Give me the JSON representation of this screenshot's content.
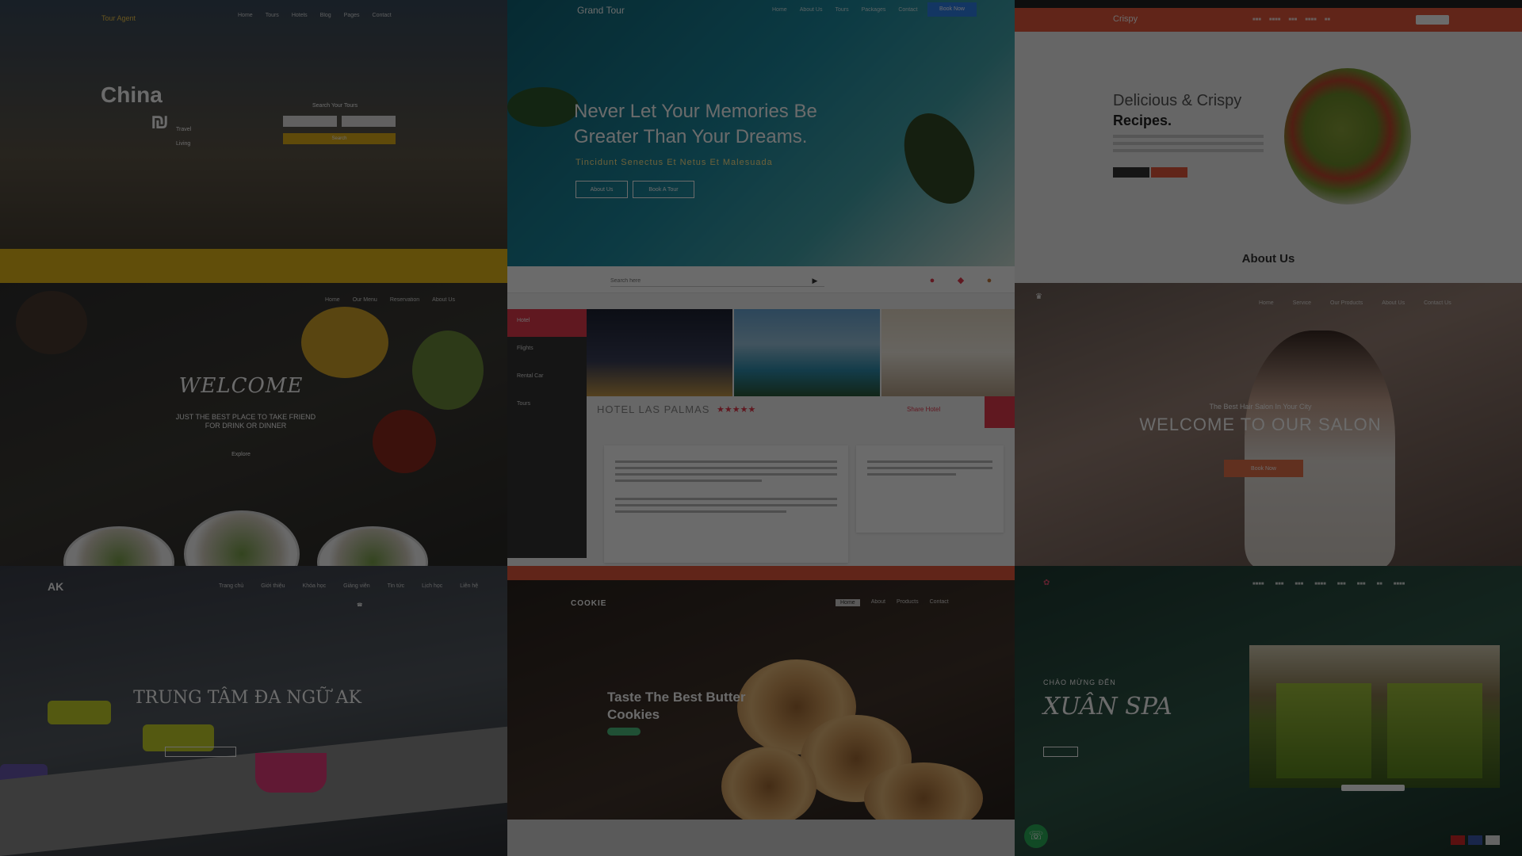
{
  "tiles": {
    "china": {
      "brand": "Tour Agent",
      "nav": [
        "Home",
        "Tours",
        "Hotels",
        "Blog",
        "Pages",
        "Contact"
      ],
      "headline": "China",
      "logo_glyph": "₪",
      "logo_items": [
        "Travel",
        "Living"
      ],
      "form_title": "Search Your Tours",
      "input1_placeholder": "",
      "input2_placeholder": "",
      "button": "Search"
    },
    "grand_tour": {
      "logo": "Grand Tour",
      "nav": [
        "Home",
        "About Us",
        "Tours",
        "Packages",
        "Contact"
      ],
      "book_button": "Book Now",
      "headline_line1": "Never Let Your Memories Be",
      "headline_line2": "Greater Than Your Dreams.",
      "subtitle": "Tincidunt Senectus Et Netus Et Malesuada",
      "button_about": "About Us",
      "button_book": "Book A Tour"
    },
    "crispy": {
      "logo": "Crispy",
      "headline_line1": "Delicious & Crispy",
      "headline_line2": "Recipes.",
      "about_heading": "About Us"
    },
    "restaurant": {
      "nav": [
        "Home",
        "Our Menu",
        "Reservation",
        "About Us"
      ],
      "welcome": "WELCOME",
      "tagline_line1": "JUST THE BEST PLACE TO TAKE FRIEND",
      "tagline_line2": "FOR DRINK OR DINNER",
      "link": "Explore"
    },
    "hotel": {
      "search_placeholder": "Search here",
      "sidebar": [
        "Hotel",
        "Flights",
        "Rental Car",
        "Tours"
      ],
      "hotel_name": "HOTEL LAS PALMAS",
      "stars": "★★★★★",
      "share": "Share Hotel"
    },
    "salon": {
      "nav": [
        "Home",
        "Service",
        "Our Products",
        "About Us",
        "Contact Us"
      ],
      "small_text": "The Best Hair Salon In Your City",
      "headline": "WELCOME TO OUR SALON",
      "button": "Book Now"
    },
    "language_center": {
      "logo": "AK",
      "nav": [
        "Trang chủ",
        "Giới thiệu",
        "Khóa học",
        "Giảng viên",
        "Tin tức",
        "Lịch học",
        "Liên hệ"
      ],
      "headline": "TRUNG TÂM ĐA NGỮ AK"
    },
    "cookie": {
      "logo": "COOKIE",
      "nav": [
        "Home",
        "About",
        "Products",
        "Contact"
      ],
      "headline_line1": "Taste The Best Butter",
      "headline_line2": "Cookies"
    },
    "spa": {
      "small_text": "CHÀO MỪNG ĐẾN",
      "headline": "XUÂN SPA",
      "call_icon": "☏"
    }
  }
}
